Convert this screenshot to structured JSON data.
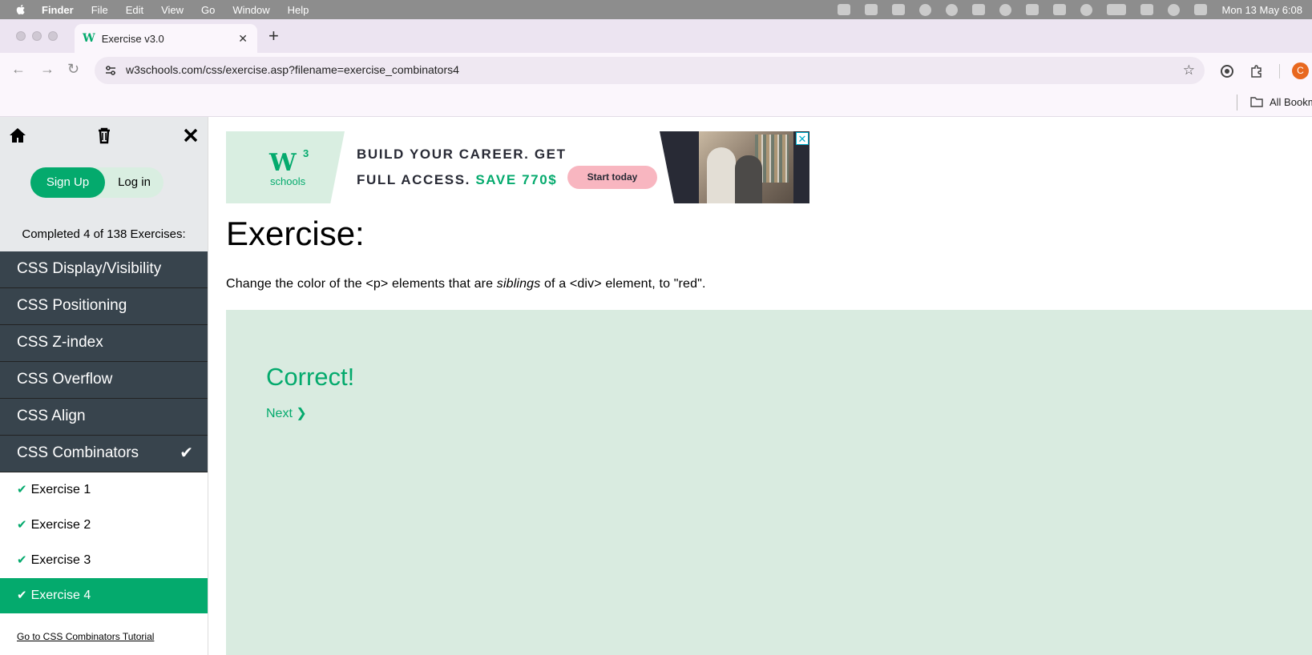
{
  "os_menubar": {
    "items": [
      "Finder",
      "File",
      "Edit",
      "View",
      "Go",
      "Window",
      "Help"
    ],
    "clock": "Mon 13 May  6:08"
  },
  "browser": {
    "tab_title": "Exercise v3.0",
    "url": "w3schools.com/css/exercise.asp?filename=exercise_combinators4",
    "bookmarks_label": "All Bookmarks",
    "profile_initial": "C"
  },
  "sidebar": {
    "signup_label": "Sign Up",
    "login_label": "Log in",
    "completed_text": "Completed 4 of 138 Exercises:",
    "categories": [
      {
        "label": "CSS Display/Visibility"
      },
      {
        "label": "CSS Positioning"
      },
      {
        "label": "CSS Z-index"
      },
      {
        "label": "CSS Overflow"
      },
      {
        "label": "CSS Align"
      },
      {
        "label": "CSS Combinators",
        "completed_mark": "✔"
      }
    ],
    "exercises": [
      {
        "label": "Exercise 1",
        "mark": "✔"
      },
      {
        "label": "Exercise 2",
        "mark": "✔"
      },
      {
        "label": "Exercise 3",
        "mark": "✔"
      },
      {
        "label": "Exercise 4",
        "mark": "✔",
        "active": true
      }
    ],
    "tutorial_link": "Go to CSS Combinators Tutorial"
  },
  "ad": {
    "logo_w3": "W",
    "logo_sup": "3",
    "logo_schools": "schools",
    "line1": "BUILD YOUR CAREER. GET",
    "line2_prefix": "FULL ACCESS.",
    "line2_highlight": "SAVE 770$",
    "cta": "Start today",
    "close": "✕"
  },
  "exercise": {
    "title": "Exercise:",
    "desc_before": "Change the color of the <p> elements that are ",
    "desc_em": "siblings",
    "desc_after": " of a <div> element, to \"red\".",
    "result_text": "Correct!",
    "next_label": "Next ❯"
  },
  "colors": {
    "brand_green": "#04aa6d",
    "sidebar_dark": "#38444d",
    "result_bg": "#d9ebe0"
  }
}
